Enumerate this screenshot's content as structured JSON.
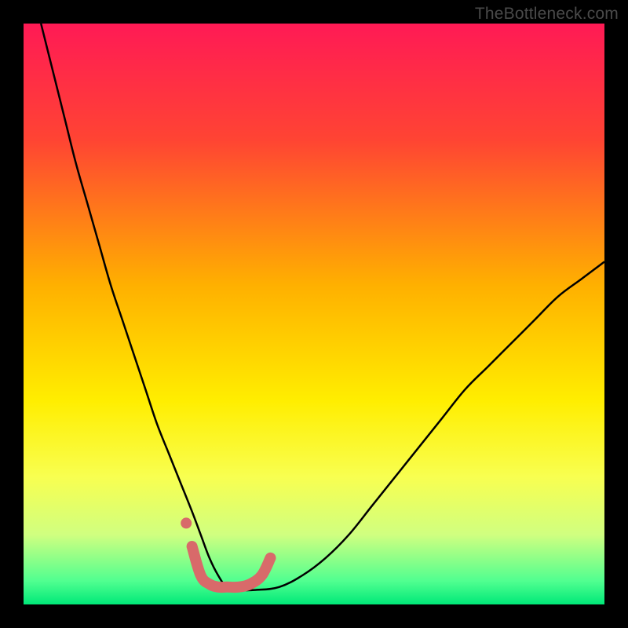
{
  "watermark": "TheBottleneck.com",
  "chart_data": {
    "type": "line",
    "title": "",
    "xlabel": "",
    "ylabel": "",
    "xlim": [
      0,
      100
    ],
    "ylim": [
      0,
      100
    ],
    "background_gradient": {
      "stops": [
        {
          "offset": 0,
          "color": "#ff1a55"
        },
        {
          "offset": 20,
          "color": "#ff4433"
        },
        {
          "offset": 45,
          "color": "#ffb000"
        },
        {
          "offset": 65,
          "color": "#ffee00"
        },
        {
          "offset": 78,
          "color": "#f8ff50"
        },
        {
          "offset": 88,
          "color": "#d0ff80"
        },
        {
          "offset": 96,
          "color": "#50ff90"
        },
        {
          "offset": 100,
          "color": "#00e878"
        }
      ]
    },
    "series": [
      {
        "name": "bottleneck-curve",
        "color": "#000000",
        "x": [
          3,
          5,
          7,
          9,
          11,
          13,
          15,
          17,
          19,
          21,
          23,
          25,
          27,
          29,
          30.5,
          32,
          33.5,
          35,
          37,
          40,
          44,
          48,
          52,
          56,
          60,
          64,
          68,
          72,
          76,
          80,
          84,
          88,
          92,
          96,
          100
        ],
        "y": [
          100,
          92,
          84,
          76,
          69,
          62,
          55,
          49,
          43,
          37,
          31,
          26,
          21,
          16,
          12,
          8,
          5,
          3,
          2.5,
          2.5,
          3,
          5,
          8,
          12,
          17,
          22,
          27,
          32,
          37,
          41,
          45,
          49,
          53,
          56,
          59
        ]
      },
      {
        "name": "bottom-indicator",
        "color": "#d86a6a",
        "stroke_width": 14,
        "x": [
          29,
          30.5,
          32,
          33.5,
          35,
          37,
          39,
          41,
          42.5
        ],
        "y": [
          10,
          5,
          3.5,
          3,
          3,
          3,
          3.5,
          5,
          8
        ]
      }
    ],
    "markers": [
      {
        "name": "left-dot",
        "x": 28,
        "y": 14,
        "r": 7,
        "color": "#d86a6a"
      }
    ]
  }
}
